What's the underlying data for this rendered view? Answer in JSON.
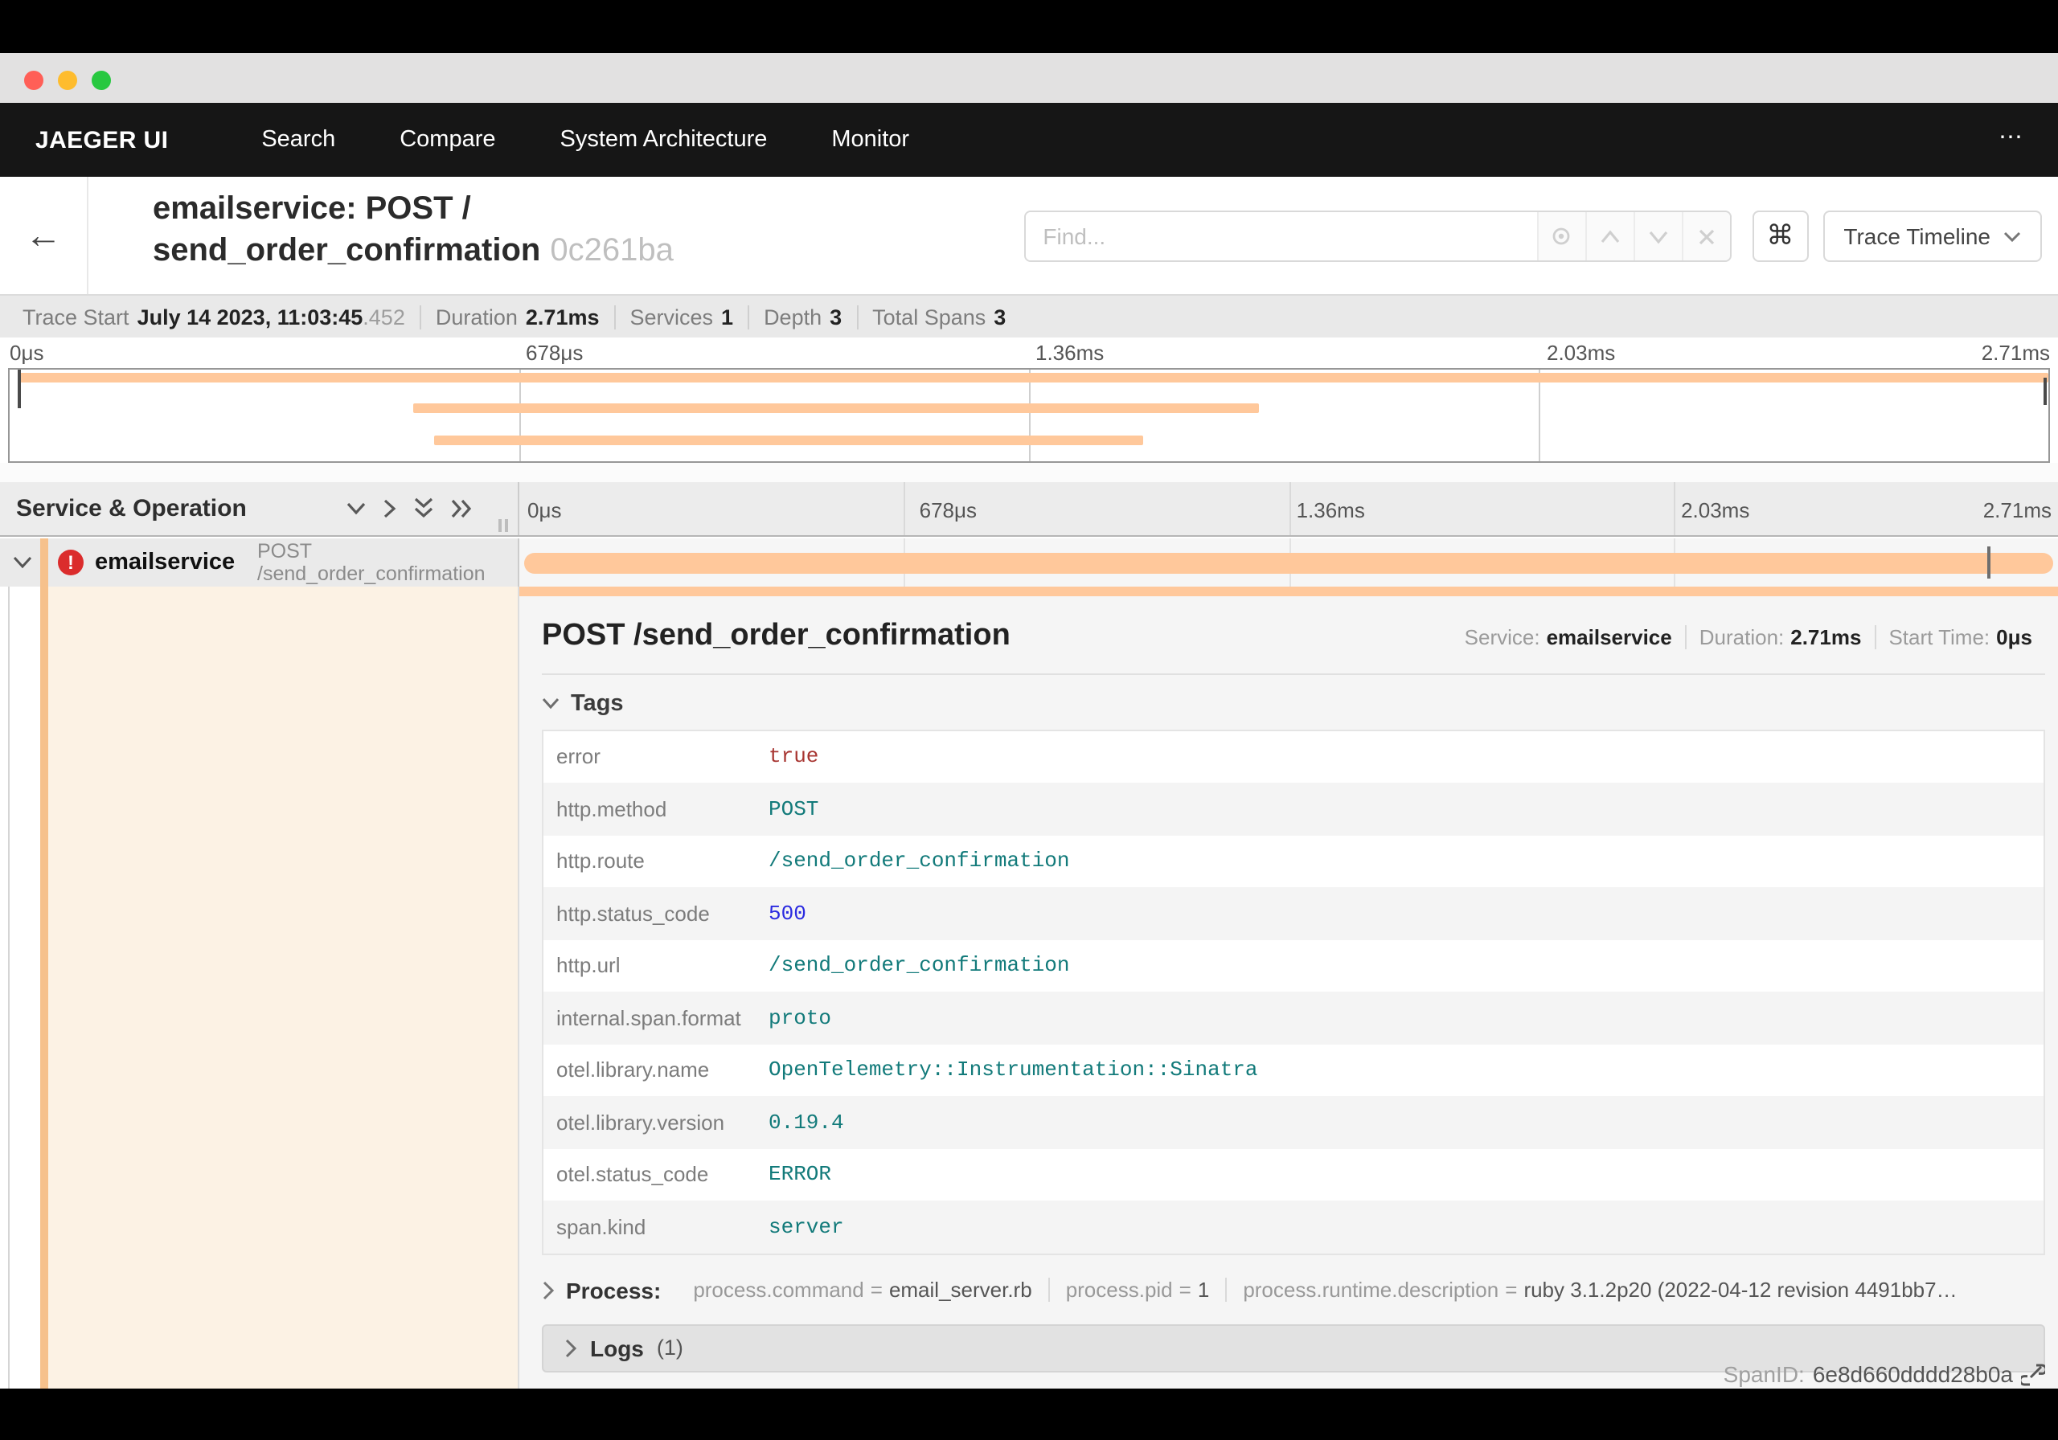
{
  "nav": {
    "brand": "JAEGER UI",
    "items": [
      "Search",
      "Compare",
      "System Architecture",
      "Monitor"
    ],
    "overflow": "⋯"
  },
  "trace_header": {
    "title_line1": "emailservice: POST /",
    "title_line2": "send_order_confirmation",
    "trace_id_short": "0c261ba",
    "find_placeholder": "Find...",
    "cmd_symbol": "⌘",
    "view_button_label": "Trace Timeline"
  },
  "summary": {
    "items": [
      {
        "label": "Trace Start",
        "value": "July 14 2023, 11:03:45",
        "suffix": ".452"
      },
      {
        "label": "Duration",
        "value": "2.71ms",
        "suffix": ""
      },
      {
        "label": "Services",
        "value": "1",
        "suffix": ""
      },
      {
        "label": "Depth",
        "value": "3",
        "suffix": ""
      },
      {
        "label": "Total Spans",
        "value": "3",
        "suffix": ""
      }
    ]
  },
  "ticks": [
    "0μs",
    "678μs",
    "1.36ms",
    "2.03ms",
    "2.71ms"
  ],
  "minimap": {
    "bars": [
      {
        "name": "root-span",
        "left_pct": 0.5,
        "width_pct": 99.5
      },
      {
        "name": "child-span",
        "left_pct": 19.8,
        "width_pct": 41.5
      },
      {
        "name": "grandchild-span",
        "left_pct": 20.8,
        "width_pct": 34.8
      }
    ]
  },
  "timeline": {
    "header_label": "Service & Operation",
    "span_row": {
      "service": "emailservice",
      "operation": "POST /send_order_confirmation",
      "bar": {
        "left_pct": 0.3,
        "width_pct": 99.4
      },
      "log_marker": {
        "left_pct": 95.4
      }
    }
  },
  "detail": {
    "title": "POST /send_order_confirmation",
    "meta": [
      {
        "label": "Service:",
        "value": "emailservice"
      },
      {
        "label": "Duration:",
        "value": "2.71ms"
      },
      {
        "label": "Start Time:",
        "value": "0μs"
      }
    ],
    "tags_label": "Tags",
    "tags": [
      {
        "key": "error",
        "value": "true",
        "type": "bool"
      },
      {
        "key": "http.method",
        "value": "POST",
        "type": "string"
      },
      {
        "key": "http.route",
        "value": "/send_order_confirmation",
        "type": "string"
      },
      {
        "key": "http.status_code",
        "value": "500",
        "type": "number"
      },
      {
        "key": "http.url",
        "value": "/send_order_confirmation",
        "type": "string"
      },
      {
        "key": "internal.span.format",
        "value": "proto",
        "type": "string"
      },
      {
        "key": "otel.library.name",
        "value": "OpenTelemetry::Instrumentation::Sinatra",
        "type": "string"
      },
      {
        "key": "otel.library.version",
        "value": "0.19.4",
        "type": "string"
      },
      {
        "key": "otel.status_code",
        "value": "ERROR",
        "type": "string"
      },
      {
        "key": "span.kind",
        "value": "server",
        "type": "string"
      }
    ],
    "process_label": "Process:",
    "process": [
      {
        "key": "process.command",
        "value": "email_server.rb"
      },
      {
        "key": "process.pid",
        "value": "1"
      },
      {
        "key": "process.runtime.description",
        "value": "ruby 3.1.2p20 (2022-04-12 revision 4491bb7…"
      }
    ],
    "logs_label": "Logs",
    "logs_count": "(1)",
    "spanid_label": "SpanID:",
    "spanid_value": "6e8d660dddd28b0a"
  },
  "colors": {
    "span_bar": "#ffc89b",
    "detail_background": "#fcf2e4",
    "error_badge": "#db2c2c",
    "value_string": "#127a7a",
    "value_number": "#2a2ae0",
    "value_bool": "#a83632",
    "navbar": "#161616"
  }
}
